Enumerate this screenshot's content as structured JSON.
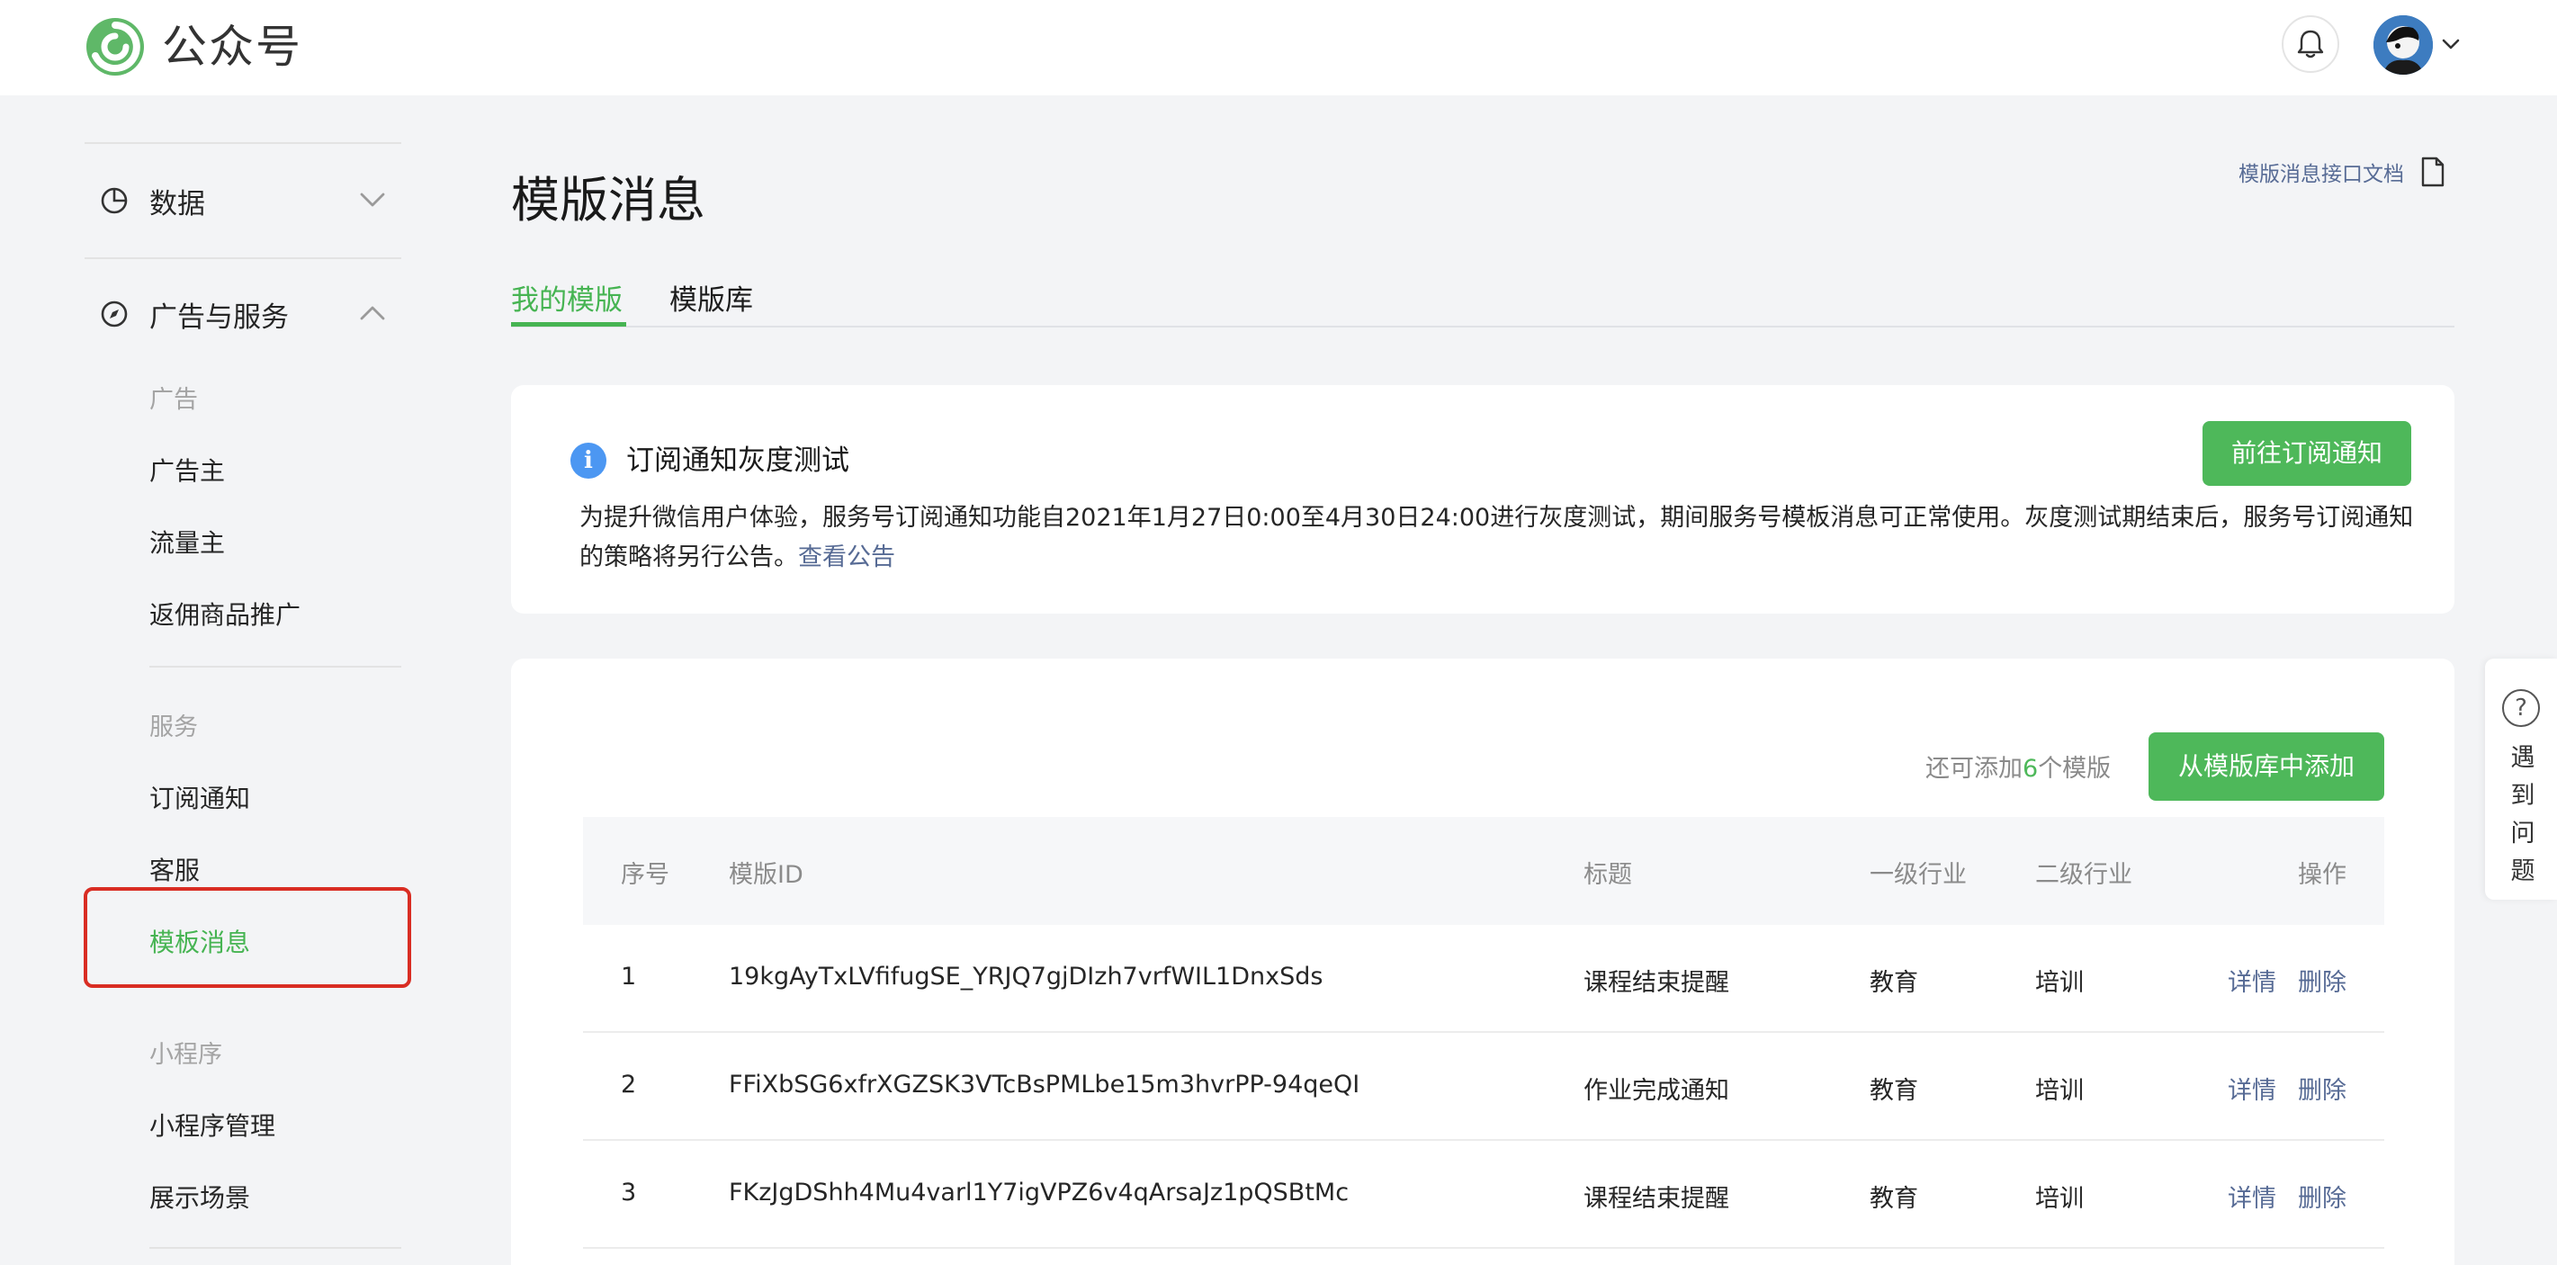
{
  "header": {
    "brand": "公众号",
    "bell_icon": "bell-icon",
    "avatar_icon": "avatar"
  },
  "sidebar": {
    "groups": [
      {
        "label": "数据",
        "icon": "pie-chart-icon",
        "expanded": false
      },
      {
        "label": "广告与服务",
        "icon": "compass-icon",
        "expanded": true
      }
    ],
    "sections": {
      "ads": {
        "caption": "广告",
        "items": [
          "广告主",
          "流量主",
          "返佣商品推广"
        ]
      },
      "services": {
        "caption": "服务",
        "items": [
          "订阅通知",
          "客服",
          "模板消息"
        ]
      },
      "miniprogram": {
        "caption": "小程序",
        "items": [
          "小程序管理",
          "展示场景"
        ]
      }
    },
    "active_item": "模板消息"
  },
  "main": {
    "title": "模版消息",
    "doc_link": "模版消息接口文档",
    "tabs": [
      {
        "label": "我的模版",
        "active": true
      },
      {
        "label": "模版库",
        "active": false
      }
    ],
    "notice": {
      "title": "订阅通知灰度测试",
      "body": "为提升微信用户体验，服务号订阅通知功能自2021年1月27日0:00至4月30日24:00进行灰度测试，期间服务号模板消息可正常使用。灰度测试期结束后，服务号订阅通知的策略将另行公告。",
      "link": "查看公告",
      "button": "前往订阅通知"
    },
    "quota": {
      "prefix": "还可添加",
      "count": "6",
      "suffix": "个模版"
    },
    "add_button": "从模版库中添加",
    "table": {
      "headers": [
        "序号",
        "模版ID",
        "标题",
        "一级行业",
        "二级行业",
        "操作"
      ],
      "rows": [
        {
          "no": "1",
          "id": "19kgAyTxLVfifugSE_YRJQ7gjDIzh7vrfWIL1DnxSds",
          "title": "课程结束提醒",
          "ind1": "教育",
          "ind2": "培训",
          "op_detail": "详情",
          "op_delete": "删除"
        },
        {
          "no": "2",
          "id": "FFiXbSG6xfrXGZSK3VTcBsPMLbe15m3hvrPP-94qeQI",
          "title": "作业完成通知",
          "ind1": "教育",
          "ind2": "培训",
          "op_detail": "详情",
          "op_delete": "删除"
        },
        {
          "no": "3",
          "id": "FKzJgDShh4Mu4varl1Y7igVPZ6v4qArsaJz1pQSBtMc",
          "title": "课程结束提醒",
          "ind1": "教育",
          "ind2": "培训",
          "op_detail": "详情",
          "op_delete": "删除"
        }
      ]
    }
  },
  "help_float": {
    "text": "遇到问题"
  },
  "colors": {
    "accent_green": "#4eb85a",
    "link_blue": "#576b95",
    "highlight_red": "#d92d23"
  }
}
